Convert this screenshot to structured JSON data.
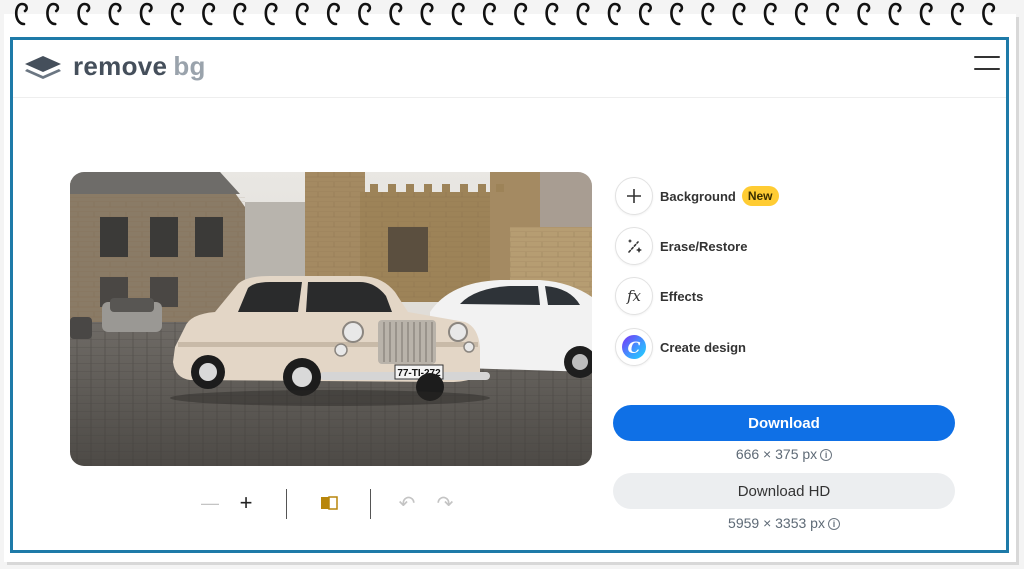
{
  "logo": {
    "word_a": "remove",
    "word_b": "bg"
  },
  "photo": {
    "plate": "77-TI-272"
  },
  "tools": [
    {
      "label": "Background",
      "badge": "New",
      "icon": "plus-icon"
    },
    {
      "label": "Erase/Restore",
      "icon": "brush-sparkle-icon"
    },
    {
      "label": "Effects",
      "icon": "fx-icon",
      "glyph": "fx"
    },
    {
      "label": "Create design",
      "icon": "canva-logo-icon",
      "glyph": "C"
    }
  ],
  "download": {
    "label": "Download",
    "size": "666 × 375 px"
  },
  "download_hd": {
    "label": "Download HD",
    "size": "5959 × 3353 px"
  },
  "toolbar": {
    "zoom_out_glyph": "—",
    "zoom_in_glyph": "+",
    "undo_glyph": "↶",
    "redo_glyph": "↷"
  },
  "info_glyph": "i",
  "colors": {
    "accent": "#0f70e6",
    "frame": "#1e7aa8",
    "badge": "#ffcc33"
  }
}
